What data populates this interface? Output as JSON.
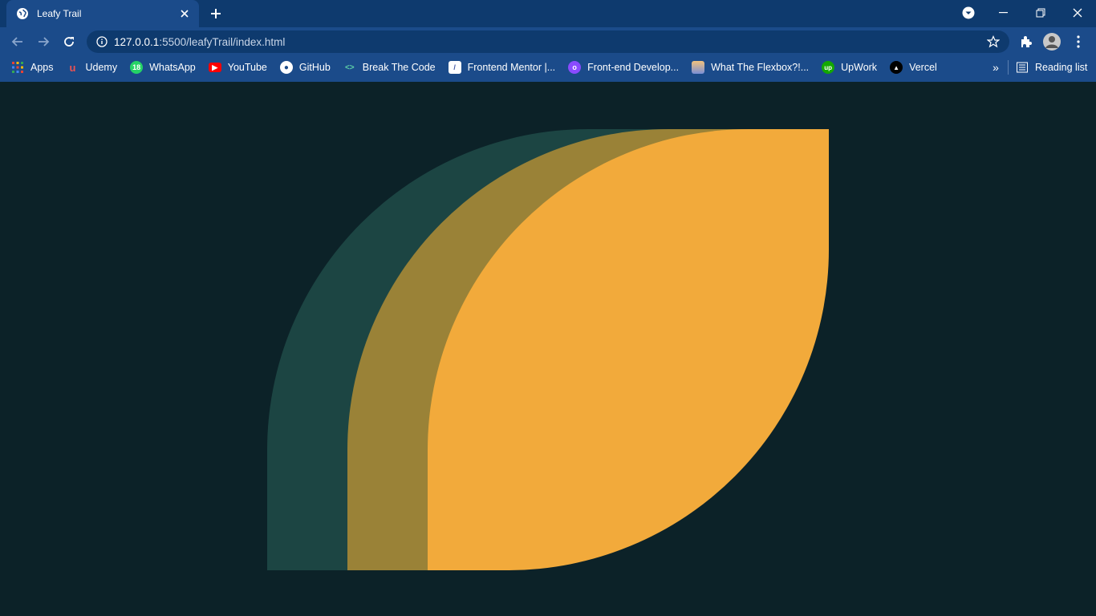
{
  "tab": {
    "title": "Leafy Trail"
  },
  "address_bar": {
    "url_host": "127.0.0.1",
    "url_path": ":5500/leafyTrail/index.html"
  },
  "bookmarks": [
    {
      "label": "Apps",
      "icon": "apps-grid-icon"
    },
    {
      "label": "Udemy",
      "icon": "udemy-icon"
    },
    {
      "label": "WhatsApp",
      "icon": "whatsapp-icon"
    },
    {
      "label": "YouTube",
      "icon": "youtube-icon"
    },
    {
      "label": "GitHub",
      "icon": "github-icon"
    },
    {
      "label": "Break The Code",
      "icon": "code-icon"
    },
    {
      "label": "Frontend Mentor |...",
      "icon": "frontend-mentor-icon"
    },
    {
      "label": "Front-end Develop...",
      "icon": "frontend-dev-icon"
    },
    {
      "label": "What The Flexbox?!...",
      "icon": "flexbox-icon"
    },
    {
      "label": "UpWork",
      "icon": "upwork-icon"
    },
    {
      "label": "Vercel",
      "icon": "vercel-icon"
    }
  ],
  "reading_list": {
    "label": "Reading list"
  },
  "colors": {
    "page_background": "#0c2228",
    "leaf_back": "#1c4543",
    "leaf_middle": "#9a8237",
    "leaf_front": "#f2aa3b"
  }
}
